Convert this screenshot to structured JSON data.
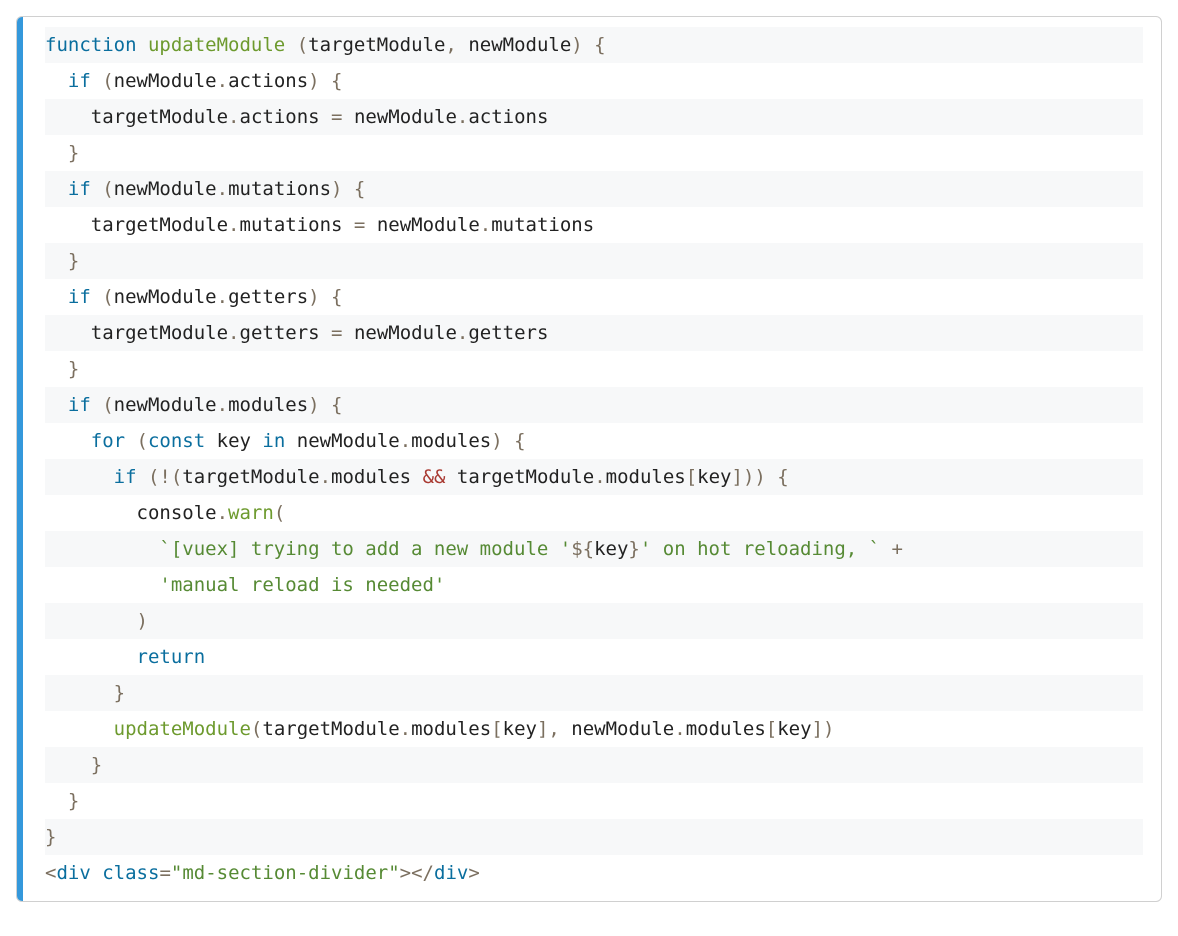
{
  "code": {
    "lines": [
      [
        {
          "cls": "tok-kw",
          "t": "function"
        },
        {
          "cls": "tok-punc",
          "t": " "
        },
        {
          "cls": "tok-fn",
          "t": "updateModule"
        },
        {
          "cls": "tok-punc",
          "t": " ("
        },
        {
          "cls": "tok-ident",
          "t": "targetModule"
        },
        {
          "cls": "tok-punc",
          "t": ", "
        },
        {
          "cls": "tok-ident",
          "t": "newModule"
        },
        {
          "cls": "tok-punc",
          "t": ") {"
        }
      ],
      [
        {
          "cls": "tok-punc",
          "t": "  "
        },
        {
          "cls": "tok-kw",
          "t": "if"
        },
        {
          "cls": "tok-punc",
          "t": " ("
        },
        {
          "cls": "tok-ident",
          "t": "newModule"
        },
        {
          "cls": "tok-punc",
          "t": "."
        },
        {
          "cls": "tok-ident",
          "t": "actions"
        },
        {
          "cls": "tok-punc",
          "t": ") {"
        }
      ],
      [
        {
          "cls": "tok-punc",
          "t": "    "
        },
        {
          "cls": "tok-ident",
          "t": "targetModule"
        },
        {
          "cls": "tok-punc",
          "t": "."
        },
        {
          "cls": "tok-ident",
          "t": "actions"
        },
        {
          "cls": "tok-punc",
          "t": " "
        },
        {
          "cls": "tok-op",
          "t": "="
        },
        {
          "cls": "tok-punc",
          "t": " "
        },
        {
          "cls": "tok-ident",
          "t": "newModule"
        },
        {
          "cls": "tok-punc",
          "t": "."
        },
        {
          "cls": "tok-ident",
          "t": "actions"
        }
      ],
      [
        {
          "cls": "tok-punc",
          "t": "  }"
        }
      ],
      [
        {
          "cls": "tok-punc",
          "t": "  "
        },
        {
          "cls": "tok-kw",
          "t": "if"
        },
        {
          "cls": "tok-punc",
          "t": " ("
        },
        {
          "cls": "tok-ident",
          "t": "newModule"
        },
        {
          "cls": "tok-punc",
          "t": "."
        },
        {
          "cls": "tok-ident",
          "t": "mutations"
        },
        {
          "cls": "tok-punc",
          "t": ") {"
        }
      ],
      [
        {
          "cls": "tok-punc",
          "t": "    "
        },
        {
          "cls": "tok-ident",
          "t": "targetModule"
        },
        {
          "cls": "tok-punc",
          "t": "."
        },
        {
          "cls": "tok-ident",
          "t": "mutations"
        },
        {
          "cls": "tok-punc",
          "t": " "
        },
        {
          "cls": "tok-op",
          "t": "="
        },
        {
          "cls": "tok-punc",
          "t": " "
        },
        {
          "cls": "tok-ident",
          "t": "newModule"
        },
        {
          "cls": "tok-punc",
          "t": "."
        },
        {
          "cls": "tok-ident",
          "t": "mutations"
        }
      ],
      [
        {
          "cls": "tok-punc",
          "t": "  }"
        }
      ],
      [
        {
          "cls": "tok-punc",
          "t": "  "
        },
        {
          "cls": "tok-kw",
          "t": "if"
        },
        {
          "cls": "tok-punc",
          "t": " ("
        },
        {
          "cls": "tok-ident",
          "t": "newModule"
        },
        {
          "cls": "tok-punc",
          "t": "."
        },
        {
          "cls": "tok-ident",
          "t": "getters"
        },
        {
          "cls": "tok-punc",
          "t": ") {"
        }
      ],
      [
        {
          "cls": "tok-punc",
          "t": "    "
        },
        {
          "cls": "tok-ident",
          "t": "targetModule"
        },
        {
          "cls": "tok-punc",
          "t": "."
        },
        {
          "cls": "tok-ident",
          "t": "getters"
        },
        {
          "cls": "tok-punc",
          "t": " "
        },
        {
          "cls": "tok-op",
          "t": "="
        },
        {
          "cls": "tok-punc",
          "t": " "
        },
        {
          "cls": "tok-ident",
          "t": "newModule"
        },
        {
          "cls": "tok-punc",
          "t": "."
        },
        {
          "cls": "tok-ident",
          "t": "getters"
        }
      ],
      [
        {
          "cls": "tok-punc",
          "t": "  }"
        }
      ],
      [
        {
          "cls": "tok-punc",
          "t": "  "
        },
        {
          "cls": "tok-kw",
          "t": "if"
        },
        {
          "cls": "tok-punc",
          "t": " ("
        },
        {
          "cls": "tok-ident",
          "t": "newModule"
        },
        {
          "cls": "tok-punc",
          "t": "."
        },
        {
          "cls": "tok-ident",
          "t": "modules"
        },
        {
          "cls": "tok-punc",
          "t": ") {"
        }
      ],
      [
        {
          "cls": "tok-punc",
          "t": "    "
        },
        {
          "cls": "tok-kw",
          "t": "for"
        },
        {
          "cls": "tok-punc",
          "t": " ("
        },
        {
          "cls": "tok-kw",
          "t": "const"
        },
        {
          "cls": "tok-punc",
          "t": " "
        },
        {
          "cls": "tok-ident",
          "t": "key"
        },
        {
          "cls": "tok-punc",
          "t": " "
        },
        {
          "cls": "tok-kw",
          "t": "in"
        },
        {
          "cls": "tok-punc",
          "t": " "
        },
        {
          "cls": "tok-ident",
          "t": "newModule"
        },
        {
          "cls": "tok-punc",
          "t": "."
        },
        {
          "cls": "tok-ident",
          "t": "modules"
        },
        {
          "cls": "tok-punc",
          "t": ") {"
        }
      ],
      [
        {
          "cls": "tok-punc",
          "t": "      "
        },
        {
          "cls": "tok-kw",
          "t": "if"
        },
        {
          "cls": "tok-punc",
          "t": " (!("
        },
        {
          "cls": "tok-ident",
          "t": "targetModule"
        },
        {
          "cls": "tok-punc",
          "t": "."
        },
        {
          "cls": "tok-ident",
          "t": "modules"
        },
        {
          "cls": "tok-punc",
          "t": " "
        },
        {
          "cls": "tok-opamp",
          "t": "&&"
        },
        {
          "cls": "tok-punc",
          "t": " "
        },
        {
          "cls": "tok-ident",
          "t": "targetModule"
        },
        {
          "cls": "tok-punc",
          "t": "."
        },
        {
          "cls": "tok-ident",
          "t": "modules"
        },
        {
          "cls": "tok-punc",
          "t": "["
        },
        {
          "cls": "tok-ident",
          "t": "key"
        },
        {
          "cls": "tok-punc",
          "t": "])) {"
        }
      ],
      [
        {
          "cls": "tok-punc",
          "t": "        "
        },
        {
          "cls": "tok-ident",
          "t": "console"
        },
        {
          "cls": "tok-punc",
          "t": "."
        },
        {
          "cls": "tok-fn",
          "t": "warn"
        },
        {
          "cls": "tok-punc",
          "t": "("
        }
      ],
      [
        {
          "cls": "tok-punc",
          "t": "          "
        },
        {
          "cls": "tok-str",
          "t": "`[vuex] trying to add a new module '"
        },
        {
          "cls": "tok-tmpl_p",
          "t": "${"
        },
        {
          "cls": "tok-ident",
          "t": "key"
        },
        {
          "cls": "tok-tmpl_p",
          "t": "}"
        },
        {
          "cls": "tok-str",
          "t": "' on hot reloading, `"
        },
        {
          "cls": "tok-punc",
          "t": " "
        },
        {
          "cls": "tok-op",
          "t": "+"
        }
      ],
      [
        {
          "cls": "tok-punc",
          "t": "          "
        },
        {
          "cls": "tok-str",
          "t": "'manual reload is needed'"
        }
      ],
      [
        {
          "cls": "tok-punc",
          "t": "        )"
        }
      ],
      [
        {
          "cls": "tok-punc",
          "t": "        "
        },
        {
          "cls": "tok-kw",
          "t": "return"
        }
      ],
      [
        {
          "cls": "tok-punc",
          "t": "      }"
        }
      ],
      [
        {
          "cls": "tok-punc",
          "t": "      "
        },
        {
          "cls": "tok-fn",
          "t": "updateModule"
        },
        {
          "cls": "tok-punc",
          "t": "("
        },
        {
          "cls": "tok-ident",
          "t": "targetModule"
        },
        {
          "cls": "tok-punc",
          "t": "."
        },
        {
          "cls": "tok-ident",
          "t": "modules"
        },
        {
          "cls": "tok-punc",
          "t": "["
        },
        {
          "cls": "tok-ident",
          "t": "key"
        },
        {
          "cls": "tok-punc",
          "t": "], "
        },
        {
          "cls": "tok-ident",
          "t": "newModule"
        },
        {
          "cls": "tok-punc",
          "t": "."
        },
        {
          "cls": "tok-ident",
          "t": "modules"
        },
        {
          "cls": "tok-punc",
          "t": "["
        },
        {
          "cls": "tok-ident",
          "t": "key"
        },
        {
          "cls": "tok-punc",
          "t": "])"
        }
      ],
      [
        {
          "cls": "tok-punc",
          "t": "    }"
        }
      ],
      [
        {
          "cls": "tok-punc",
          "t": "  }"
        }
      ],
      [
        {
          "cls": "tok-punc",
          "t": "}"
        }
      ],
      [
        {
          "cls": "tok-punc",
          "t": "<"
        },
        {
          "cls": "tok-tag",
          "t": "div"
        },
        {
          "cls": "tok-punc",
          "t": " "
        },
        {
          "cls": "tok-attr",
          "t": "class"
        },
        {
          "cls": "tok-punc",
          "t": "="
        },
        {
          "cls": "tok-aval",
          "t": "\"md-section-divider\""
        },
        {
          "cls": "tok-punc",
          "t": "></"
        },
        {
          "cls": "tok-tag",
          "t": "div"
        },
        {
          "cls": "tok-punc",
          "t": ">"
        }
      ]
    ]
  }
}
